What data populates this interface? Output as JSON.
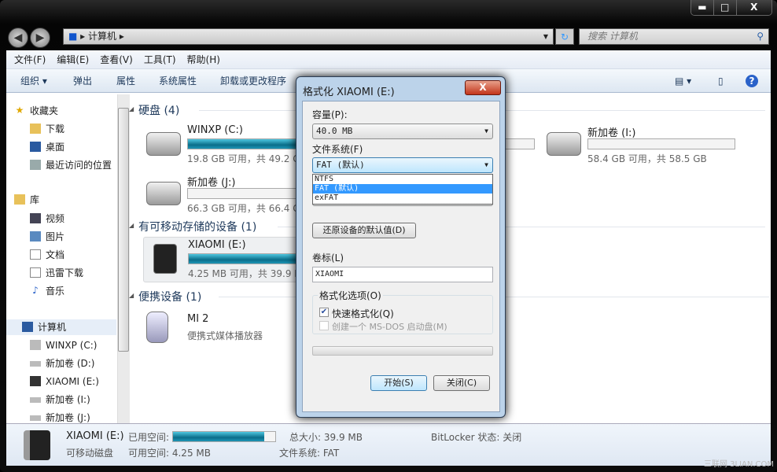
{
  "window": {
    "minimize": "▬",
    "maximize": "□",
    "close": "X"
  },
  "address": {
    "root_label": "计算机",
    "refresh": "↻",
    "search_placeholder": "搜索 计算机"
  },
  "menu": [
    "文件(F)",
    "编辑(E)",
    "查看(V)",
    "工具(T)",
    "帮助(H)"
  ],
  "toolbar": {
    "organize": "组织 ▾",
    "eject": "弹出",
    "properties": "属性",
    "system_properties": "系统属性",
    "uninstall": "卸载或更改程序",
    "view": "▤ ▾",
    "help": "?"
  },
  "sidebar": {
    "favorites": "收藏夹",
    "downloads": "下载",
    "desktop": "桌面",
    "recent": "最近访问的位置",
    "libraries": "库",
    "videos": "视频",
    "pictures": "图片",
    "documents": "文档",
    "xunlei": "迅雷下载",
    "music": "音乐",
    "computer": "计算机",
    "drives": [
      "WINXP (C:)",
      "新加卷 (D:)",
      "XIAOMI (E:)",
      "新加卷 (I:)",
      "新加卷 (J:)"
    ]
  },
  "groups": {
    "hdd": "硬盘 (4)",
    "removable": "有可移动存储的设备 (1)",
    "portable": "便携设备 (1)"
  },
  "drives": [
    {
      "name": "WINXP (C:)",
      "sub": "19.8 GB 可用，共 49.2 GB",
      "used_pct": 60
    },
    {
      "name": "新加卷 (J:)",
      "sub": "66.3 GB 可用，共 66.4 GB",
      "used_pct": 0
    },
    {
      "name": "新加卷 (I:)",
      "sub": "58.4 GB 可用，共 58.5 GB",
      "used_pct": 0
    },
    {
      "name": "XIAOMI (E:)",
      "sub": "4.25 MB 可用，共 39.9 MB",
      "used_pct": 89
    }
  ],
  "portable": {
    "name": "MI 2",
    "type": "便携式媒体播放器"
  },
  "status": {
    "name": "XIAOMI (E:)",
    "type": "可移动磁盘",
    "used_label": "已用空间:",
    "free": "可用空间: 4.25 MB",
    "total": "总大小: 39.9 MB",
    "fs": "文件系统: FAT",
    "bitlocker": "BitLocker 状态: 关闭",
    "used_pct": 89
  },
  "dialog": {
    "title": "格式化 XIAOMI (E:)",
    "close": "X",
    "capacity_label": "容量(P):",
    "capacity": "40.0 MB",
    "fs_label": "文件系统(F)",
    "fs_value": "FAT (默认)",
    "fs_options": [
      "NTFS",
      "FAT (默认)",
      "exFAT"
    ],
    "restore": "还原设备的默认值(D)",
    "volume_label": "卷标(L)",
    "volume": "XIAOMI",
    "options_label": "格式化选项(O)",
    "quick": "快速格式化(Q)",
    "quick_checked": true,
    "msdos": "创建一个 MS-DOS 启动盘(M)",
    "start": "开始(S)",
    "close_btn": "关闭(C)",
    "progress_pct": 0
  },
  "watermark": "三联网 3LIAN.COM"
}
